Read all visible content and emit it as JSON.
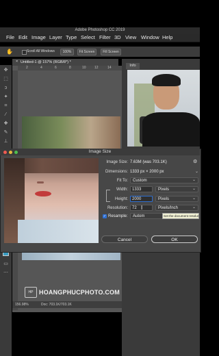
{
  "app": {
    "title": "Adobe Photoshop CC 2019"
  },
  "menu": [
    "File",
    "Edit",
    "Image",
    "Layer",
    "Type",
    "Select",
    "Filter",
    "3D",
    "View",
    "Window",
    "Help"
  ],
  "options_bar": {
    "scroll_all_windows": "Scroll All Windows",
    "zoom": "100%",
    "fit_screen": "Fit Screen",
    "fill_screen": "Fill Screen"
  },
  "document": {
    "tab": "Untitled-1 @ 157% (RGB/8*) *",
    "ruler_ticks": [
      "2",
      "4",
      "6",
      "8",
      "10",
      "12",
      "14"
    ],
    "status_zoom": "156.98%",
    "status_doc": "Doc: 703.1K/703.1K"
  },
  "info_panel": {
    "tab": "Info"
  },
  "dialog": {
    "title": "Image Size",
    "image_size_label": "Image Size:",
    "image_size_value": "7.63M (was 703.1K)",
    "dimensions_label": "Dimensions:",
    "dimensions_value": "1333 px × 2000 px",
    "fit_to_label": "Fit To:",
    "fit_to_value": "Custom",
    "width_label": "Width:",
    "width_value": "1333",
    "width_unit": "Pixels",
    "height_label": "Height:",
    "height_value": "2000",
    "height_unit": "Pixels",
    "resolution_label": "Resolution:",
    "resolution_value": "72",
    "resolution_unit": "Pixels/Inch",
    "resample_label": "Resample:",
    "resample_value": "Autom",
    "resample_checked": true,
    "tooltip": "Set the document resolution",
    "cancel": "Cancel",
    "ok": "OK"
  },
  "watermark": {
    "logo": "HP",
    "text": "HOANGPHUCPHOTO.COM"
  },
  "colors": {
    "accent": "#2f6fd0",
    "dialog_bg": "#474747",
    "light_red": "#ee5b52",
    "light_yellow": "#e9b93c",
    "light_green": "#4fbe4f"
  }
}
